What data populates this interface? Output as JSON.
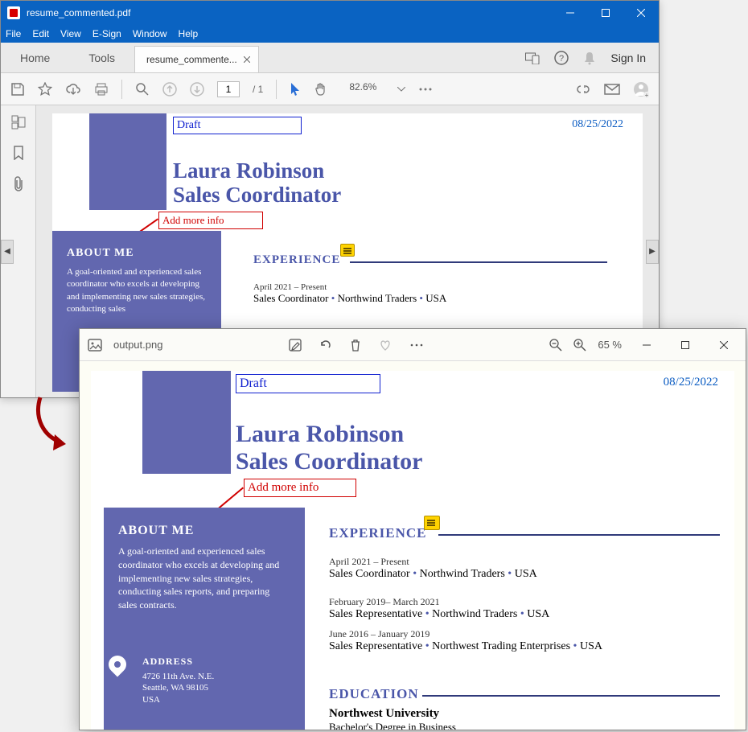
{
  "acrobat": {
    "title": "resume_commented.pdf",
    "menu": {
      "file": "File",
      "edit": "Edit",
      "view": "View",
      "esign": "E-Sign",
      "window": "Window",
      "help": "Help"
    },
    "tabs": {
      "home": "Home",
      "tools": "Tools",
      "doc": "resume_commente...",
      "signin": "Sign In"
    },
    "toolbar": {
      "page_current": "1",
      "page_sep": "/ 1",
      "zoom": "82.6%"
    }
  },
  "viewer": {
    "filename": "output.png",
    "zoom": "65 %"
  },
  "doc": {
    "draft": "Draft",
    "date": "08/25/2022",
    "name": "Laura Robinson",
    "role": "Sales Coordinator",
    "comment": "Add more info",
    "about_title": "ABOUT ME",
    "about_text_short": "A goal-oriented and experienced sales coordinator who excels at developing and implementing new sales strategies, conducting sales",
    "about_text_long": "A goal-oriented and experienced sales coordinator who excels at developing and implementing new sales strategies, conducting sales reports, and preparing sales contracts.",
    "exp_title": "EXPERIENCE",
    "edu_title": "EDUCATION",
    "exp": [
      {
        "period": "April 2021 – Present",
        "role": "Sales Coordinator",
        "company": "Northwind Traders",
        "loc": "USA"
      },
      {
        "period": "February 2019– March 2021",
        "role": "Sales Representative",
        "company": "Northwind Traders",
        "loc": "USA"
      },
      {
        "period": "June 2016 – January 2019",
        "role": "Sales Representative",
        "company": "Northwest Trading Enterprises",
        "loc": "USA"
      }
    ],
    "addr_title": "ADDRESS",
    "addr": {
      "line1": "4726 11th Ave. N.E.",
      "line2": "Seattle, WA 98105",
      "line3": "USA"
    },
    "edu_school": "Northwest University",
    "edu_degree": "Bachelor's Degree in Business"
  }
}
